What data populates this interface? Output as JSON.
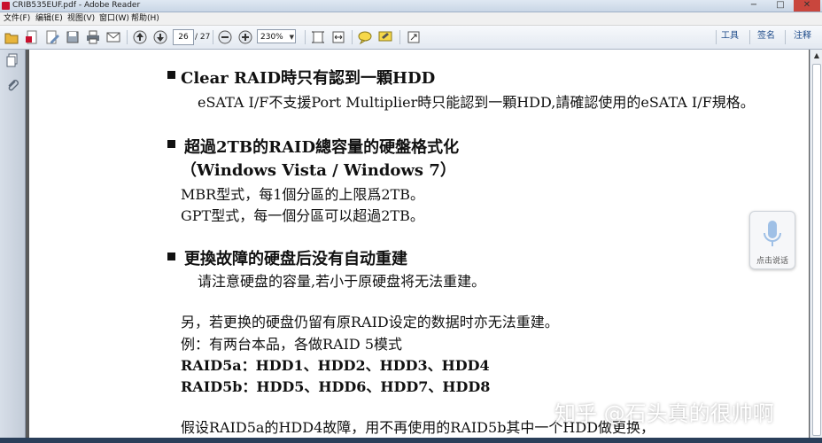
{
  "window": {
    "title": "CRIB535EUF.pdf - Adobe Reader",
    "controls": {
      "minimize": "−",
      "maximize": "□",
      "close": "✕"
    }
  },
  "menu": [
    "文件(F)",
    "编辑(E)",
    "视图(V)",
    "窗口(W)",
    "帮助(H)"
  ],
  "toolbar": {
    "page_current": "26",
    "page_total": "/ 27",
    "zoom": "230%",
    "right_buttons": [
      "工具",
      "签名",
      "注释"
    ]
  },
  "document": {
    "sections": [
      {
        "heading": "Clear RAID時只有認到一顆HDD",
        "lines": [
          "eSATA I/F不支援Port Multiplier時只能認到一顆HDD,請確認使用的eSATA I/F規格。"
        ]
      },
      {
        "heading": "超過2TB的RAID總容量的硬盤格式化",
        "subheading": "（Windows Vista / Windows 7）",
        "lines": [
          "MBR型式，每1個分區的上限爲2TB。",
          "GPT型式，每一個分區可以超過2TB。"
        ]
      },
      {
        "heading": "更換故障的硬盘后没有自动重建",
        "lines": [
          "请注意硬盘的容量,若小于原硬盘将无法重建。"
        ]
      }
    ],
    "paragraph": [
      "另，若更换的硬盘仍留有原RAID设定的数据时亦无法重建。",
      "例：有两台本品，各做RAID 5模式"
    ],
    "bold_lines": [
      "RAID5a：HDD1、HDD2、HDD3、HDD4",
      "RAID5b：HDD5、HDD6、HDD7、HDD8"
    ],
    "last_line": "假设RAID5a的HDD4故障，用不再使用的RAID5b其中一个HDD做更换，"
  },
  "voice_widget": {
    "label": "点击说话"
  },
  "watermark": "知乎 @石头真的很帅啊"
}
